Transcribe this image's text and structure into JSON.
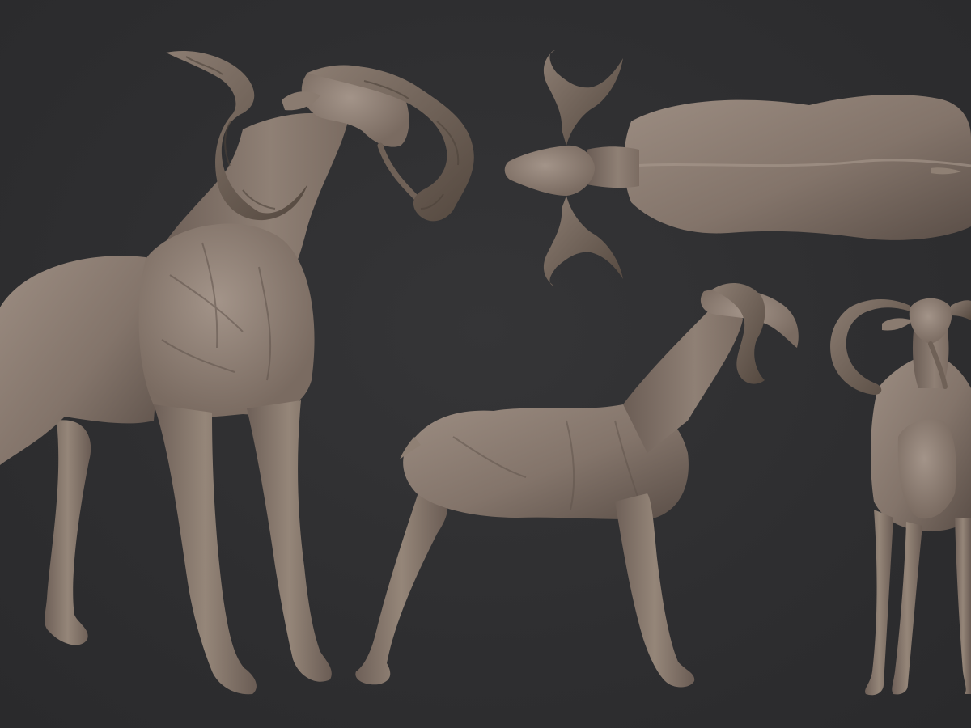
{
  "scene": {
    "description_label": "",
    "views": [
      {
        "id": "perspective",
        "icon": "creature-sculpt-perspective"
      },
      {
        "id": "top",
        "icon": "creature-sculpt-top"
      },
      {
        "id": "side",
        "icon": "creature-sculpt-side"
      },
      {
        "id": "front",
        "icon": "creature-sculpt-front"
      }
    ]
  },
  "colors": {
    "background": "#2f2f31",
    "clay_light": "#9a8b80",
    "clay_mid": "#7e6f65",
    "clay_dark": "#4f443e"
  }
}
